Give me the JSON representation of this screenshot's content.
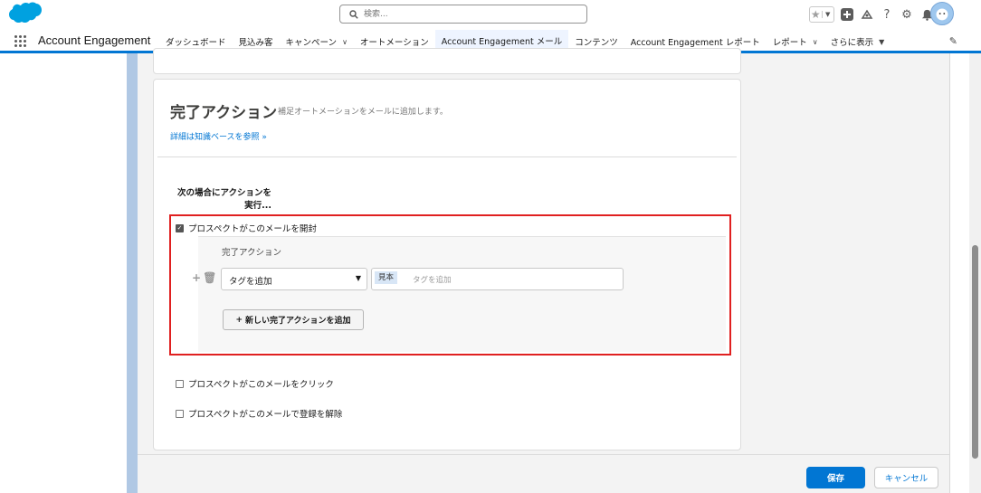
{
  "header": {
    "search_placeholder": "検索...",
    "icons": [
      "favorites-star-icon",
      "add-icon",
      "trailhead-icon",
      "help-icon",
      "setup-gear-icon",
      "notifications-bell-icon",
      "user-avatar"
    ]
  },
  "nav": {
    "app_name": "Account Engagement",
    "tabs": [
      {
        "label": "ダッシュボード",
        "dropdown": false
      },
      {
        "label": "見込み客",
        "dropdown": false
      },
      {
        "label": "キャンペーン",
        "dropdown": true
      },
      {
        "label": "オートメーション",
        "dropdown": false
      },
      {
        "label": "Account Engagement メール",
        "dropdown": false,
        "active": true
      },
      {
        "label": "コンテンツ",
        "dropdown": false
      },
      {
        "label": "Account Engagement レポート",
        "dropdown": false
      },
      {
        "label": "レポート",
        "dropdown": true
      },
      {
        "label": "さらに表示",
        "dropdown": true
      }
    ]
  },
  "section": {
    "title": "完了アクション",
    "subtitle": "補足オートメーションをメールに追加します。",
    "kb_link": "詳細は知識ベースを参照 »",
    "when_label": "次の場合にアクションを実行..."
  },
  "conditions": [
    {
      "label": "プロスペクトがこのメールを開封",
      "checked": true
    },
    {
      "label": "プロスペクトがこのメールをクリック",
      "checked": false
    },
    {
      "label": "プロスペクトがこのメールで登録を解除",
      "checked": false
    }
  ],
  "action_panel": {
    "heading": "完了アクション",
    "action_type": "タグを追加",
    "tag_value": "見本",
    "tag_placeholder": "タグを追加",
    "add_button": "新しい完了アクションを追加"
  },
  "footer": {
    "save": "保存",
    "cancel": "キャンセル"
  },
  "colors": {
    "brand_blue": "#0176d3",
    "highlight_red": "#e02020"
  }
}
